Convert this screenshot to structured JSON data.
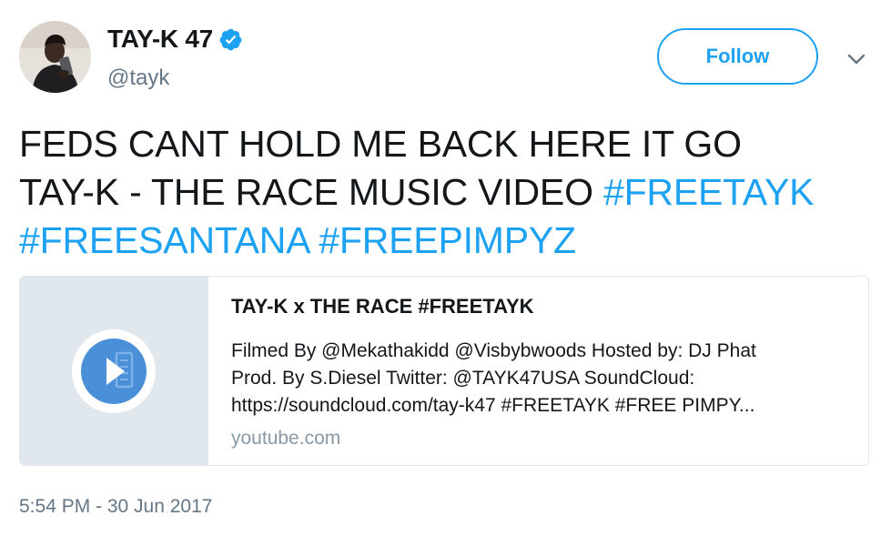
{
  "author": {
    "display_name": "TAY-K 47",
    "handle": "@tayk",
    "verified": true
  },
  "actions": {
    "follow_label": "Follow"
  },
  "tweet": {
    "text_line1": "FEDS CANT HOLD ME BACK HERE IT GO",
    "text_line2": "TAY-K - THE RACE MUSIC VIDEO",
    "hashtag1": "#FREETAYK",
    "hashtag2": "#FREESANTANA",
    "hashtag3": "#FREEPIMPYZ",
    "timestamp": "5:54 PM - 30 Jun 2017"
  },
  "card": {
    "title": "TAY-K x THE RACE #FREETAYK",
    "description_line1": "Filmed By @Mekathakidd @Visbybwoods Hosted by: DJ Phat",
    "description_line2": "Prod. By S.Diesel Twitter: @TAYK47USA SoundCloud:",
    "description_line3": "https://soundcloud.com/tay-k47 #FREETAYK #FREE PIMPY...",
    "domain": "youtube.com"
  },
  "icons": {
    "verified": "verified-badge-icon",
    "caret": "chevron-down-icon",
    "play": "play-icon"
  },
  "colors": {
    "accent": "#1da1f2",
    "secondary_text": "#657786",
    "card_media_bg": "#e1e8ed",
    "play_icon": "#4a90d9"
  }
}
